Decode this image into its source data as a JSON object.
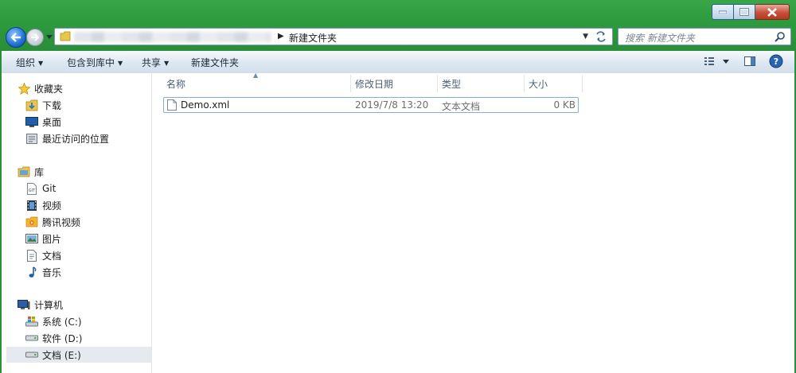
{
  "window": {
    "caption_buttons": [
      "minimize",
      "maximize",
      "close"
    ]
  },
  "address": {
    "current_folder": "新建文件夹",
    "search_placeholder": "搜索 新建文件夹"
  },
  "toolbar": {
    "organize": "组织",
    "include_in_library": "包含到库中",
    "share": "共享",
    "new_folder": "新建文件夹"
  },
  "sidebar": {
    "favorites": {
      "label": "收藏夹",
      "items": [
        "下载",
        "桌面",
        "最近访问的位置"
      ]
    },
    "libraries": {
      "label": "库",
      "items": [
        "Git",
        "视频",
        "腾讯视频",
        "图片",
        "文档",
        "音乐"
      ]
    },
    "computer": {
      "label": "计算机",
      "items": [
        "系统 (C:)",
        "软件 (D:)",
        "文档 (E:)"
      ],
      "selected_index": 2
    }
  },
  "file_list": {
    "columns": {
      "name": "名称",
      "date": "修改日期",
      "type": "类型",
      "size": "大小"
    },
    "rows": [
      {
        "name": "Demo.xml",
        "date": "2019/7/8 13:20",
        "type": "文本文档",
        "size": "0 KB"
      }
    ]
  },
  "colors": {
    "frame": "#2e9a3e",
    "selection_border": "#84acdd",
    "selected_nav_bg": "#e6eaef"
  }
}
